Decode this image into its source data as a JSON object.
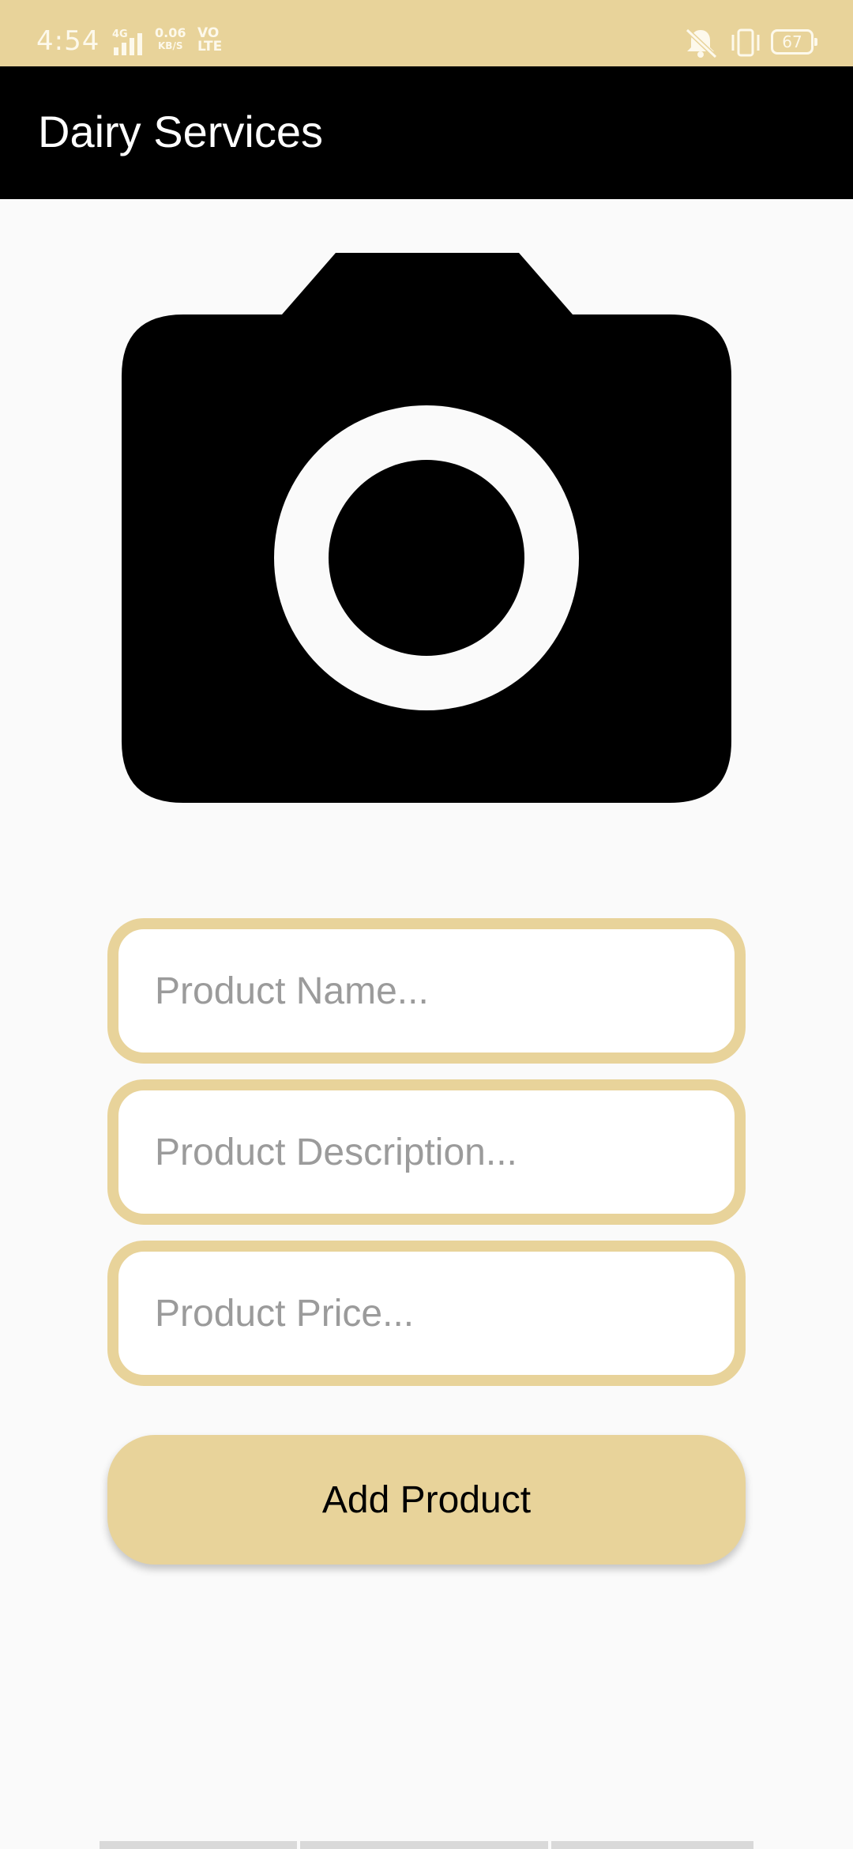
{
  "status_bar": {
    "time": "4:54",
    "network_type": "4G",
    "data_speed": "0.06",
    "data_unit": "KB/S",
    "volte_line1": "VO",
    "volte_line2": "LTE",
    "battery": "67",
    "icons": [
      "signal-icon",
      "mute-icon",
      "vibrate-icon",
      "battery-icon"
    ]
  },
  "app_bar": {
    "title": "Dairy Services"
  },
  "image_picker": {
    "icon": "camera-icon"
  },
  "form": {
    "name_placeholder": "Product Name...",
    "description_placeholder": "Product Description...",
    "price_placeholder": "Product Price...",
    "submit_label": "Add Product"
  },
  "colors": {
    "accent": "#e8d39a",
    "app_bar": "#000000",
    "background": "#fafafa"
  }
}
